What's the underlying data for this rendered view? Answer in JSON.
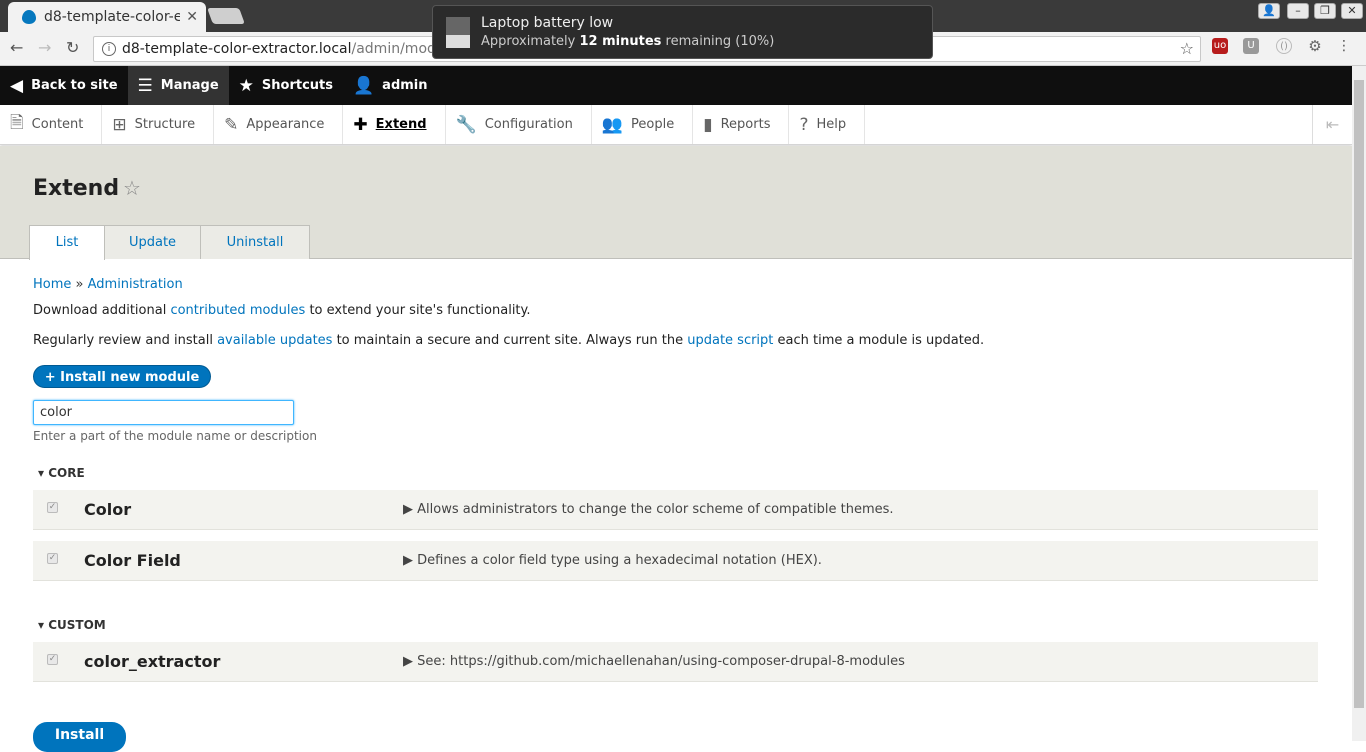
{
  "browser": {
    "tab_title": "d8-template-color-e",
    "url_host": "d8-template-color-extractor.local",
    "url_path": "/admin/modules"
  },
  "notification": {
    "title": "Laptop battery low",
    "text_prefix": "Approximately ",
    "text_bold": "12 minutes",
    "text_suffix": " remaining (10%)"
  },
  "admin_toolbar": {
    "back": "Back to site",
    "manage": "Manage",
    "shortcuts": "Shortcuts",
    "user": "admin"
  },
  "tray": {
    "content": "Content",
    "structure": "Structure",
    "appearance": "Appearance",
    "extend": "Extend",
    "configuration": "Configuration",
    "people": "People",
    "reports": "Reports",
    "help": "Help"
  },
  "page": {
    "title": "Extend",
    "tabs": {
      "list": "List",
      "update": "Update",
      "uninstall": "Uninstall"
    }
  },
  "breadcrumb": {
    "home": "Home",
    "sep": " » ",
    "admin": "Administration"
  },
  "intro": {
    "p1_a": "Download additional ",
    "p1_link": "contributed modules",
    "p1_b": " to extend your site's functionality.",
    "p2_a": "Regularly review and install ",
    "p2_link1": "available updates",
    "p2_b": " to maintain a secure and current site. Always run the ",
    "p2_link2": "update script",
    "p2_c": " each time a module is updated."
  },
  "install_new": "+ Install new module",
  "filter": {
    "value": "color",
    "hint": "Enter a part of the module name or description"
  },
  "packages": [
    {
      "name": "▾ CORE"
    },
    {
      "name": "▾ CUSTOM"
    }
  ],
  "modules": [
    {
      "name": "Color",
      "desc": "▶ Allows administrators to change the color scheme of compatible themes."
    },
    {
      "name": "Color Field",
      "desc": "▶ Defines a color field type using a hexadecimal notation (HEX)."
    },
    {
      "name": "color_extractor",
      "desc": "▶ See: https://github.com/michaellenahan/using-composer-drupal-8-modules"
    }
  ],
  "install_button": "Install"
}
